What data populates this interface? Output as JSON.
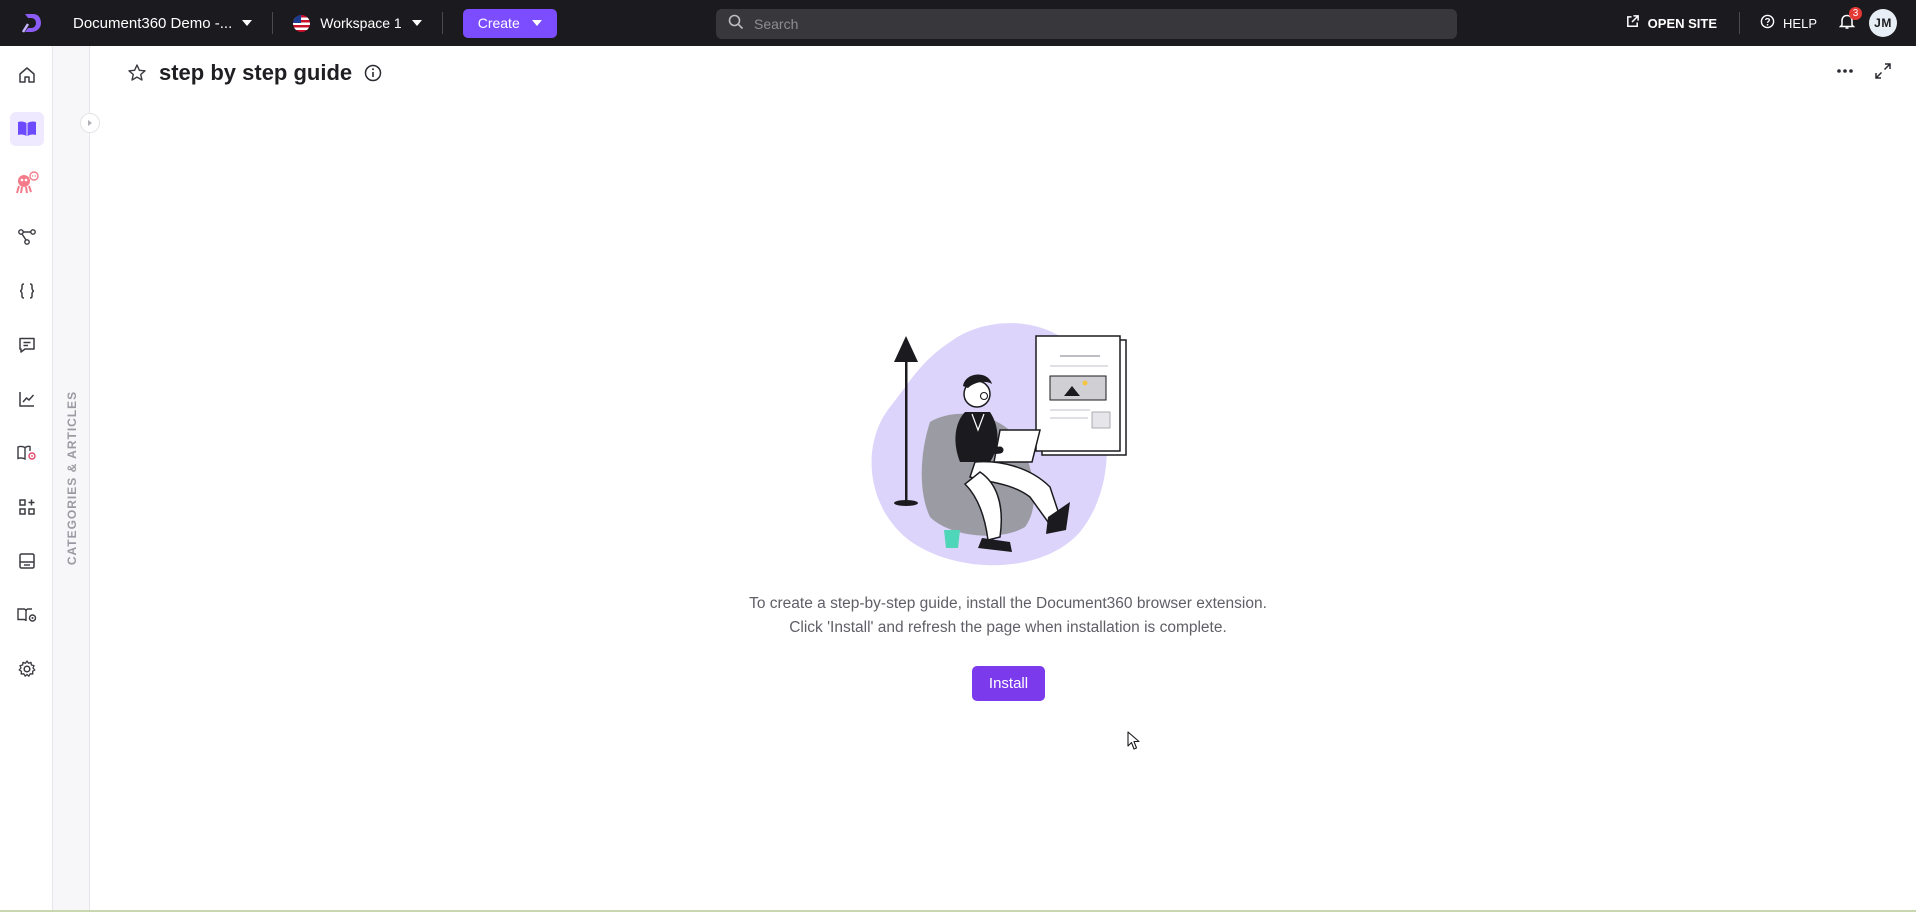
{
  "topbar": {
    "project_name": "Document360 Demo -...",
    "workspace": "Workspace 1",
    "create_label": "Create",
    "search_placeholder": "Search",
    "open_site_label": "OPEN SITE",
    "help_label": "HELP",
    "notification_count": "3",
    "avatar_initials": "JM"
  },
  "leftnav": {
    "items": [
      {
        "icon": "home-icon"
      },
      {
        "icon": "book-open-icon",
        "active": true
      },
      {
        "icon": "ai-assistant-icon"
      },
      {
        "icon": "workflow-icon"
      },
      {
        "icon": "curly-braces-icon"
      },
      {
        "icon": "message-icon"
      },
      {
        "icon": "analytics-icon"
      },
      {
        "icon": "book-settings-icon"
      },
      {
        "icon": "apps-icon"
      },
      {
        "icon": "widget-icon"
      },
      {
        "icon": "knowledge-base-settings-icon"
      },
      {
        "icon": "gear-icon"
      }
    ]
  },
  "categories_strip": {
    "label": "CATEGORIES & ARTICLES"
  },
  "page": {
    "title": "step by step guide"
  },
  "empty_state": {
    "line1": "To create a step-by-step guide, install the Document360 browser extension.",
    "line2": "Click 'Install' and refresh the page when installation is complete.",
    "install_label": "Install"
  },
  "colors": {
    "accent": "#7c4dff",
    "install_button": "#7c3aed",
    "topbar_bg": "#1b1b1f",
    "illustration_blob": "#dcd4fb"
  }
}
